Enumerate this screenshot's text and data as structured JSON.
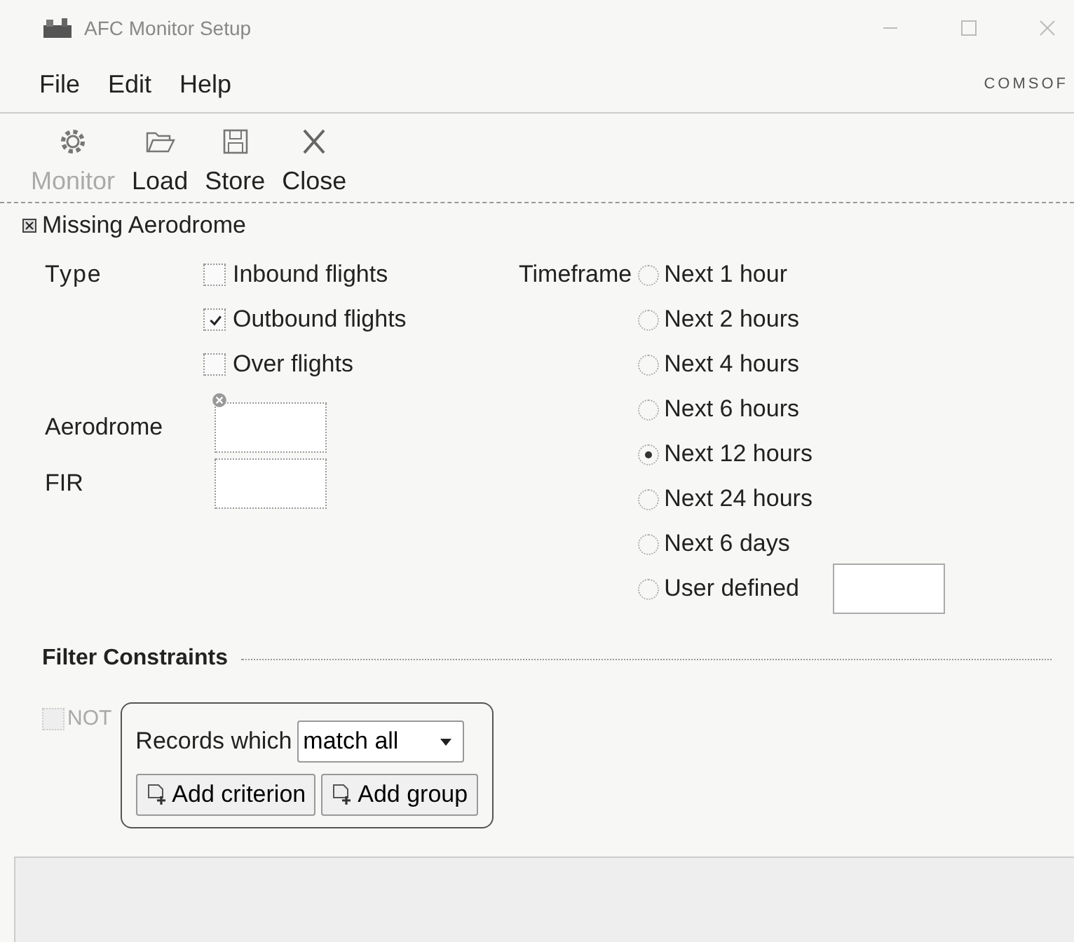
{
  "window": {
    "title": "AFC Monitor Setup"
  },
  "menu": [
    {
      "label": "File"
    },
    {
      "label": "Edit"
    },
    {
      "label": "Help"
    }
  ],
  "logo": "COMSOF",
  "toolbar": [
    {
      "label": "Monitor",
      "kind": "gear",
      "disabled": true
    },
    {
      "label": "Load",
      "kind": "folder",
      "disabled": false
    },
    {
      "label": "Store",
      "kind": "disk",
      "disabled": false
    },
    {
      "label": "Close",
      "kind": "close",
      "disabled": false
    }
  ],
  "section": {
    "title": "Missing Aerodrome"
  },
  "type": {
    "label": "Type",
    "options": [
      {
        "label": "Inbound flights",
        "checked": false
      },
      {
        "label": "Outbound flights",
        "checked": true
      },
      {
        "label": "Over flights",
        "checked": false
      }
    ]
  },
  "aerodrome": {
    "label": "Aerodrome"
  },
  "fir": {
    "label": "FIR"
  },
  "timeframe": {
    "label": "Timeframe",
    "options": [
      {
        "label": "Next 1 hour",
        "selected": false
      },
      {
        "label": "Next 2 hours",
        "selected": false
      },
      {
        "label": "Next 4 hours",
        "selected": false
      },
      {
        "label": "Next 6 hours",
        "selected": false
      },
      {
        "label": "Next 12 hours",
        "selected": true
      },
      {
        "label": "Next 24 hours",
        "selected": false
      },
      {
        "label": "Next 6 days",
        "selected": false
      },
      {
        "label": "User defined",
        "selected": false
      }
    ]
  },
  "filter": {
    "title": "Filter Constraints",
    "not": {
      "label": "NOT",
      "checked": false,
      "disabled": true
    },
    "records_label": "Records which",
    "match": "match all",
    "buttons": [
      "Add criterion",
      "Add group"
    ]
  }
}
